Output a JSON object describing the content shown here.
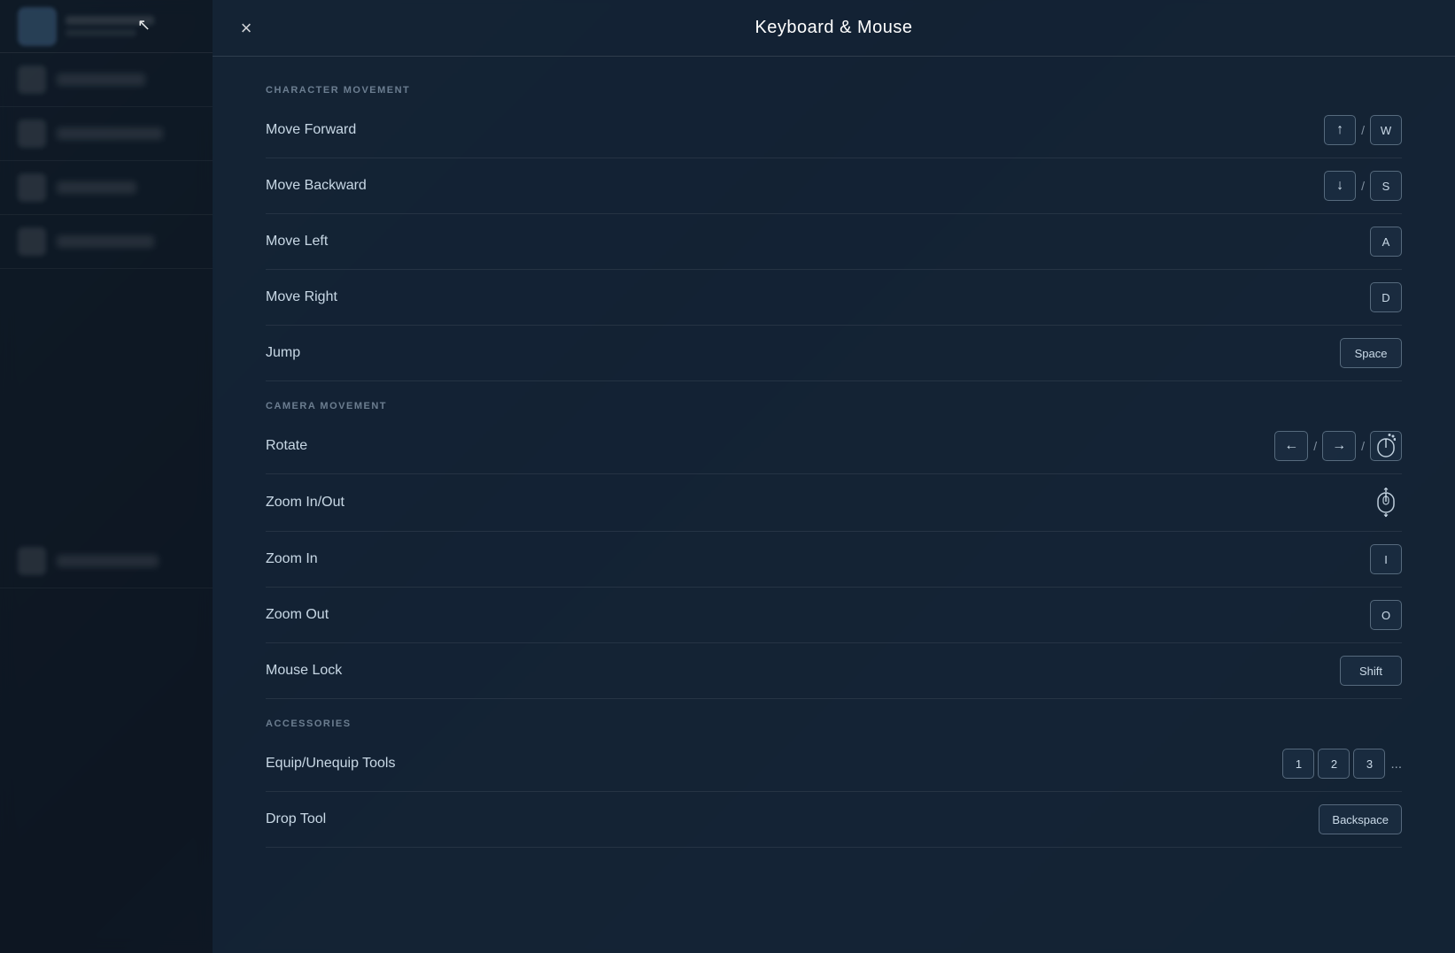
{
  "header": {
    "title": "Keyboard & Mouse",
    "close_label": "×"
  },
  "cursor": "↖",
  "sections": [
    {
      "id": "character-movement",
      "label": "CHARACTER MOVEMENT",
      "bindings": [
        {
          "id": "move-forward",
          "label": "Move Forward",
          "keys": [
            {
              "type": "arrow",
              "value": "↑"
            },
            {
              "type": "separator",
              "value": "/"
            },
            {
              "type": "key",
              "value": "W"
            }
          ]
        },
        {
          "id": "move-backward",
          "label": "Move Backward",
          "keys": [
            {
              "type": "arrow",
              "value": "↓"
            },
            {
              "type": "separator",
              "value": "/"
            },
            {
              "type": "key",
              "value": "S"
            }
          ]
        },
        {
          "id": "move-left",
          "label": "Move Left",
          "keys": [
            {
              "type": "key",
              "value": "A"
            }
          ]
        },
        {
          "id": "move-right",
          "label": "Move Right",
          "keys": [
            {
              "type": "key",
              "value": "D"
            }
          ]
        },
        {
          "id": "jump",
          "label": "Jump",
          "keys": [
            {
              "type": "wide",
              "value": "Space"
            }
          ]
        }
      ]
    },
    {
      "id": "camera-movement",
      "label": "CAMERA MOVEMENT",
      "bindings": [
        {
          "id": "rotate",
          "label": "Rotate",
          "keys": [
            {
              "type": "arrow",
              "value": "←"
            },
            {
              "type": "separator",
              "value": "/"
            },
            {
              "type": "arrow",
              "value": "→"
            },
            {
              "type": "separator",
              "value": "/"
            },
            {
              "type": "mouse-drag",
              "value": ""
            }
          ]
        },
        {
          "id": "zoom-in-out",
          "label": "Zoom In/Out",
          "keys": [
            {
              "type": "mouse-scroll",
              "value": ""
            }
          ]
        },
        {
          "id": "zoom-in",
          "label": "Zoom In",
          "keys": [
            {
              "type": "key",
              "value": "I"
            }
          ]
        },
        {
          "id": "zoom-out",
          "label": "Zoom Out",
          "keys": [
            {
              "type": "key",
              "value": "O"
            }
          ]
        },
        {
          "id": "mouse-lock",
          "label": "Mouse Lock",
          "keys": [
            {
              "type": "wide",
              "value": "Shift"
            }
          ]
        }
      ]
    },
    {
      "id": "accessories",
      "label": "ACCESSORIES",
      "bindings": [
        {
          "id": "equip-unequip-tools",
          "label": "Equip/Unequip Tools",
          "keys": [
            {
              "type": "num",
              "value": "1"
            },
            {
              "type": "num",
              "value": "2"
            },
            {
              "type": "num",
              "value": "3"
            },
            {
              "type": "ellipsis",
              "value": "..."
            }
          ]
        },
        {
          "id": "drop-tool",
          "label": "Drop Tool",
          "keys": [
            {
              "type": "wide",
              "value": "Backspace"
            }
          ]
        }
      ]
    }
  ]
}
